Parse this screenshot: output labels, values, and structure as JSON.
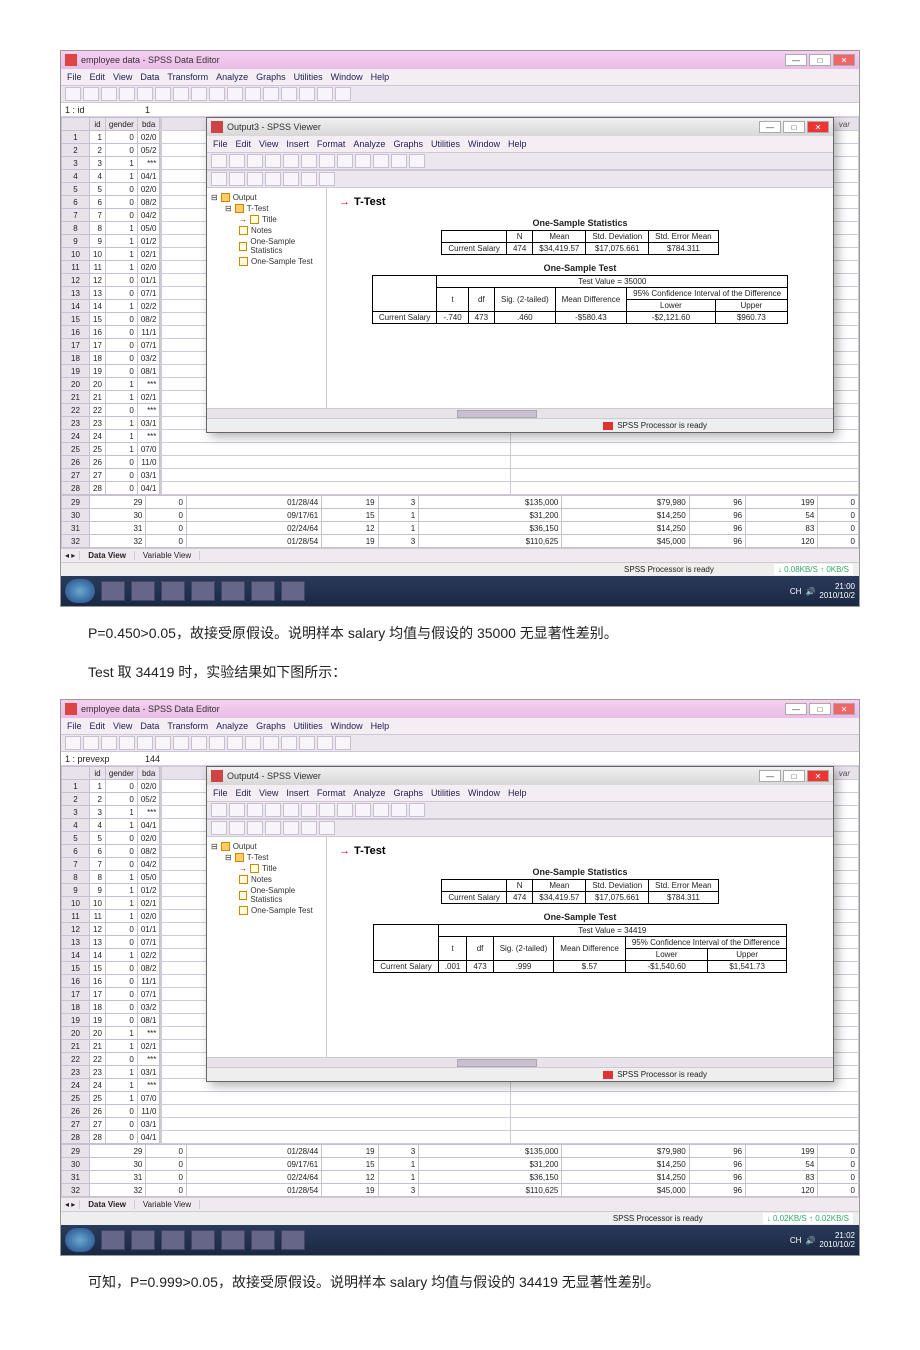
{
  "screenshot1": {
    "window_title": "employee data - SPSS Data Editor",
    "menus": [
      "File",
      "Edit",
      "View",
      "Data",
      "Transform",
      "Analyze",
      "Graphs",
      "Utilities",
      "Window",
      "Help"
    ],
    "cell_label": "1 : id",
    "cell_value": "1",
    "grid_headers": [
      "",
      "id",
      "gender",
      "bda"
    ],
    "grid_rows": [
      [
        "1",
        "1",
        "0",
        "02/0"
      ],
      [
        "2",
        "2",
        "0",
        "05/2"
      ],
      [
        "3",
        "3",
        "1",
        "***"
      ],
      [
        "4",
        "4",
        "1",
        "04/1"
      ],
      [
        "5",
        "5",
        "0",
        "02/0"
      ],
      [
        "6",
        "6",
        "0",
        "08/2"
      ],
      [
        "7",
        "7",
        "0",
        "04/2"
      ],
      [
        "8",
        "8",
        "1",
        "05/0"
      ],
      [
        "9",
        "9",
        "1",
        "01/2"
      ],
      [
        "10",
        "10",
        "1",
        "02/1"
      ],
      [
        "11",
        "11",
        "1",
        "02/0"
      ],
      [
        "12",
        "12",
        "0",
        "01/1"
      ],
      [
        "13",
        "13",
        "0",
        "07/1"
      ],
      [
        "14",
        "14",
        "1",
        "02/2"
      ],
      [
        "15",
        "15",
        "0",
        "08/2"
      ],
      [
        "16",
        "16",
        "0",
        "11/1"
      ],
      [
        "17",
        "17",
        "0",
        "07/1"
      ],
      [
        "18",
        "18",
        "0",
        "03/2"
      ],
      [
        "19",
        "19",
        "0",
        "08/1"
      ],
      [
        "20",
        "20",
        "1",
        "***"
      ],
      [
        "21",
        "21",
        "1",
        "02/1"
      ],
      [
        "22",
        "22",
        "0",
        "***"
      ],
      [
        "23",
        "23",
        "1",
        "03/1"
      ],
      [
        "24",
        "24",
        "1",
        "***"
      ],
      [
        "25",
        "25",
        "1",
        "07/0"
      ],
      [
        "26",
        "26",
        "0",
        "11/0"
      ],
      [
        "27",
        "27",
        "0",
        "03/1"
      ],
      [
        "28",
        "28",
        "0",
        "04/1"
      ]
    ],
    "bottom_rows": [
      [
        "29",
        "29",
        "0",
        "01/28/44",
        "19",
        "3",
        "$135,000",
        "$79,980",
        "96",
        "199",
        "0"
      ],
      [
        "30",
        "30",
        "0",
        "09/17/61",
        "15",
        "1",
        "$31,200",
        "$14,250",
        "96",
        "54",
        "0"
      ],
      [
        "31",
        "31",
        "0",
        "02/24/64",
        "12",
        "1",
        "$36,150",
        "$14,250",
        "96",
        "83",
        "0"
      ],
      [
        "32",
        "32",
        "0",
        "01/28/54",
        "19",
        "3",
        "$110,625",
        "$45,000",
        "96",
        "120",
        "0"
      ]
    ],
    "tabs": [
      "Data View",
      "Variable View"
    ],
    "status": "SPSS Processor is ready",
    "netspeed": "↓ 0.08KB/S ↑ 0KB/S",
    "clock": "21:00",
    "date": "2010/10/2",
    "viewer": {
      "title": "Output3 - SPSS Viewer",
      "menus": [
        "File",
        "Edit",
        "View",
        "Insert",
        "Format",
        "Analyze",
        "Graphs",
        "Utilities",
        "Window",
        "Help"
      ],
      "tree": {
        "root": "Output",
        "child": "T-Test",
        "items": [
          "Title",
          "Notes",
          "One-Sample Statistics",
          "One-Sample Test"
        ]
      },
      "heading": "T-Test",
      "one_sample_stats": {
        "title": "One-Sample Statistics",
        "headers": [
          "",
          "N",
          "Mean",
          "Std. Deviation",
          "Std. Error Mean"
        ],
        "row": [
          "Current Salary",
          "474",
          "$34,419.57",
          "$17,075.661",
          "$784.311"
        ]
      },
      "one_sample_test": {
        "title": "One-Sample Test",
        "test_value": "Test Value = 35000",
        "ci_header": "95% Confidence Interval of the Difference",
        "headers": [
          "",
          "t",
          "df",
          "Sig. (2-tailed)",
          "Mean Difference",
          "Lower",
          "Upper"
        ],
        "row": [
          "Current Salary",
          "-.740",
          "473",
          ".460",
          "-$580.43",
          "-$2,121.60",
          "$960.73"
        ]
      },
      "status": "SPSS Processor is ready"
    }
  },
  "text1": "P=0.450>0.05，故接受原假设。说明样本 salary 均值与假设的 35000 无显著性差别。",
  "text2": "Test 取 34419 时，实验结果如下图所示：",
  "screenshot2": {
    "window_title": "employee data - SPSS Data Editor",
    "cell_label": "1 : prevexp",
    "cell_value": "144",
    "grid_rows": [
      [
        "1",
        "1",
        "0",
        "02/0"
      ],
      [
        "2",
        "2",
        "0",
        "05/2"
      ],
      [
        "3",
        "3",
        "1",
        "***"
      ],
      [
        "4",
        "4",
        "1",
        "04/1"
      ],
      [
        "5",
        "5",
        "0",
        "02/0"
      ],
      [
        "6",
        "6",
        "0",
        "08/2"
      ],
      [
        "7",
        "7",
        "0",
        "04/2"
      ],
      [
        "8",
        "8",
        "1",
        "05/0"
      ],
      [
        "9",
        "9",
        "1",
        "01/2"
      ],
      [
        "10",
        "10",
        "1",
        "02/1"
      ],
      [
        "11",
        "11",
        "1",
        "02/0"
      ],
      [
        "12",
        "12",
        "0",
        "01/1"
      ],
      [
        "13",
        "13",
        "0",
        "07/1"
      ],
      [
        "14",
        "14",
        "1",
        "02/2"
      ],
      [
        "15",
        "15",
        "0",
        "08/2"
      ],
      [
        "16",
        "16",
        "0",
        "11/1"
      ],
      [
        "17",
        "17",
        "0",
        "07/1"
      ],
      [
        "18",
        "18",
        "0",
        "03/2"
      ],
      [
        "19",
        "19",
        "0",
        "08/1"
      ],
      [
        "20",
        "20",
        "1",
        "***"
      ],
      [
        "21",
        "21",
        "1",
        "02/1"
      ],
      [
        "22",
        "22",
        "0",
        "***"
      ],
      [
        "23",
        "23",
        "1",
        "03/1"
      ],
      [
        "24",
        "24",
        "1",
        "***"
      ],
      [
        "25",
        "25",
        "1",
        "07/0"
      ],
      [
        "26",
        "26",
        "0",
        "11/0"
      ],
      [
        "27",
        "27",
        "0",
        "03/1"
      ],
      [
        "28",
        "28",
        "0",
        "04/1"
      ]
    ],
    "netspeed": "↓ 0.02KB/S ↑ 0.02KB/S",
    "clock": "21:02",
    "date": "2010/10/2",
    "viewer": {
      "title": "Output4 - SPSS Viewer",
      "one_sample_test": {
        "test_value": "Test Value = 34419",
        "row": [
          "Current Salary",
          ".001",
          "473",
          ".999",
          "$.57",
          "-$1,540.60",
          "$1,541.73"
        ]
      }
    }
  },
  "text3": "可知，P=0.999>0.05，故接受原假设。说明样本 salary 均值与假设的 34419 无显著性差别。",
  "var_label": "var"
}
